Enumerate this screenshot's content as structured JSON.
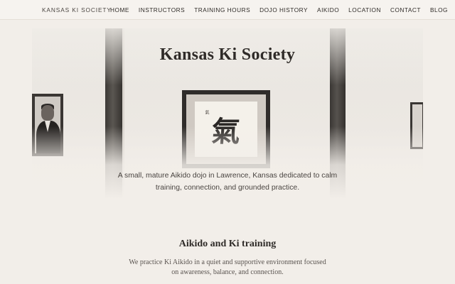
{
  "nav": {
    "brand": "KANSAS KI SOCIETY",
    "items": [
      {
        "label": "HOME"
      },
      {
        "label": "INSTRUCTORS"
      },
      {
        "label": "TRAINING HOURS"
      },
      {
        "label": "DOJO HISTORY"
      },
      {
        "label": "AIKIDO"
      },
      {
        "label": "LOCATION"
      },
      {
        "label": "CONTACT"
      },
      {
        "label": "BLOG"
      }
    ]
  },
  "hero": {
    "title": "Kansas Ki Society",
    "description_line1": "A small, mature Aikido dojo in Lawrence, Kansas dedicated to calm",
    "description_line2": "training, connection, and grounded practice.",
    "calligraphy": "氣"
  },
  "section": {
    "title": "Aikido and Ki training",
    "text_line1": "We practice Ki Aikido in a quiet and supportive environment focused",
    "text_line2": "on awareness, balance, and connection."
  },
  "colors": {
    "background": "#f2eee9",
    "text": "#2f2b28",
    "wood": "#3d3a37"
  }
}
